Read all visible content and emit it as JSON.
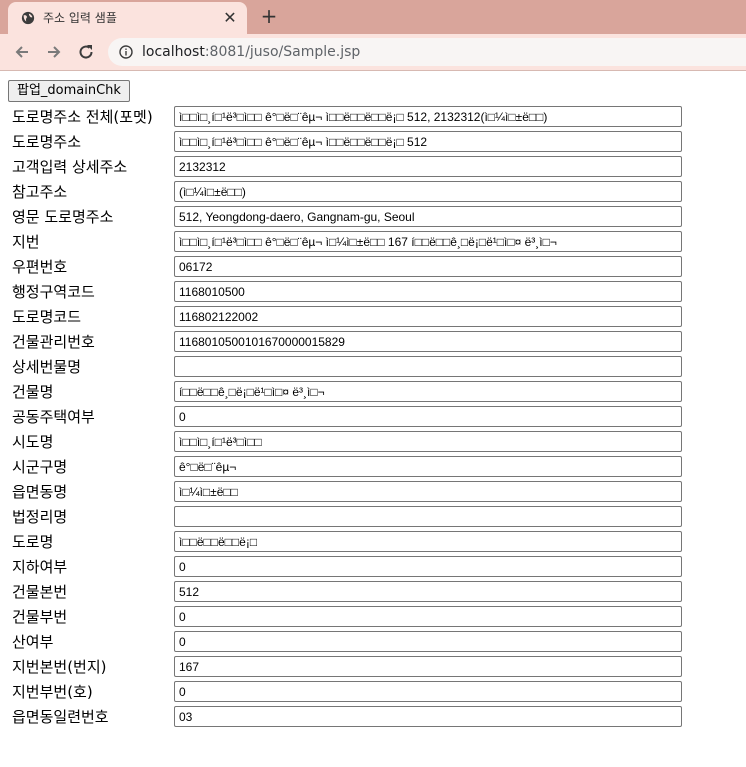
{
  "browser": {
    "tab_title": "주소 입력 샘플",
    "tab_close": "✕",
    "new_tab": "+",
    "url_host": "localhost",
    "url_rest": ":8081/juso/Sample.jsp"
  },
  "page": {
    "popup_button": "팝업_domainChk",
    "fields": [
      {
        "label": "도로명주소 전체(포멧)",
        "value": "ì□□ì□¸í□¹ë³□ì□□ ê°□ë□¨êµ¬ ì□□ë□□ë□□ë¡□ 512, 2132312(ì□¼ì□±ë□□)"
      },
      {
        "label": "도로명주소",
        "value": "ì□□ì□¸í□¹ë³□ì□□ ê°□ë□¨êµ¬ ì□□ë□□ë□□ë¡□ 512"
      },
      {
        "label": "고객입력 상세주소",
        "value": "2132312"
      },
      {
        "label": "참고주소",
        "value": "(ì□¼ì□±ë□□)"
      },
      {
        "label": "영문 도로명주소",
        "value": "512, Yeongdong-daero, Gangnam-gu, Seoul"
      },
      {
        "label": "지번",
        "value": "ì□□ì□¸í□¹ë³□ì□□ ê°□ë□¨êµ¬ ì□¼ì□±ë□□ 167 í□□ë□□ê¸□ë¡□ë¹□ì□¤ ë³¸ì□¬"
      },
      {
        "label": "우편번호",
        "value": "06172"
      },
      {
        "label": "행정구역코드",
        "value": "1168010500"
      },
      {
        "label": "도로명코드",
        "value": "116802122002"
      },
      {
        "label": "건물관리번호",
        "value": "1168010500101670000015829"
      },
      {
        "label": "상세번물명",
        "value": ""
      },
      {
        "label": "건물명",
        "value": "í□□ë□□ê¸□ë¡□ë¹□ì□¤ ë³¸ì□¬"
      },
      {
        "label": "공동주택여부",
        "value": "0"
      },
      {
        "label": "시도명",
        "value": "ì□□ì□¸í□¹ë³□ì□□"
      },
      {
        "label": "시군구명",
        "value": "ê°□ë□¨êµ¬"
      },
      {
        "label": "읍면동명",
        "value": "ì□¼ì□±ë□□"
      },
      {
        "label": "법정리명",
        "value": ""
      },
      {
        "label": "도로명",
        "value": "ì□□ë□□ë□□ë¡□"
      },
      {
        "label": "지하여부",
        "value": "0"
      },
      {
        "label": "건물본번",
        "value": "512"
      },
      {
        "label": "건물부번",
        "value": "0"
      },
      {
        "label": "산여부",
        "value": "0"
      },
      {
        "label": "지번본번(번지)",
        "value": "167"
      },
      {
        "label": "지번부번(호)",
        "value": "0"
      },
      {
        "label": "읍면동일련번호",
        "value": "03"
      }
    ]
  }
}
